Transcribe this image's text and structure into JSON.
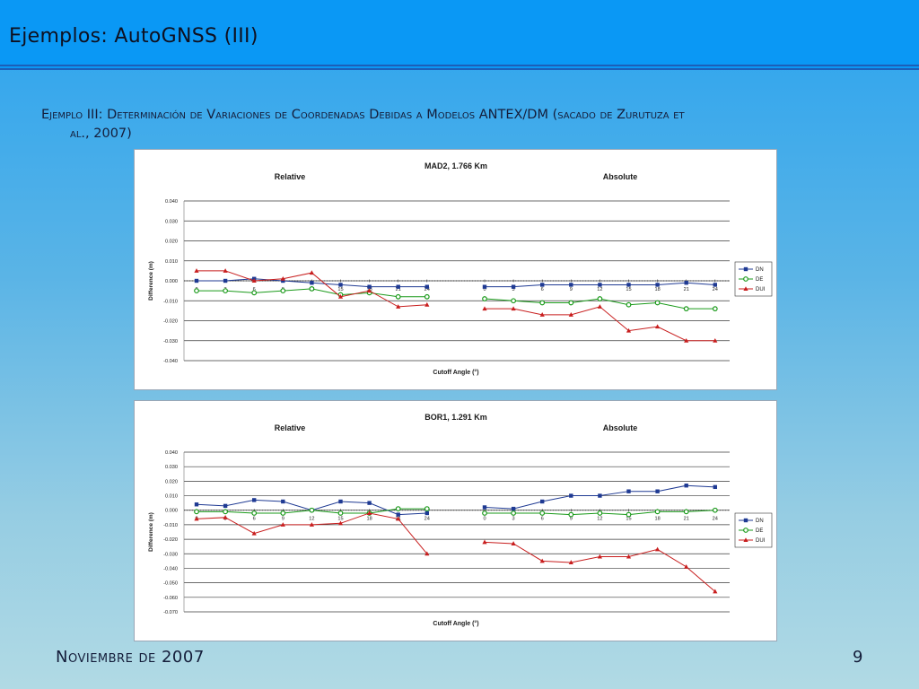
{
  "slide": {
    "title": "Ejemplos: AutoGNSS (III)",
    "subtitle_line1": "Ejemplo III: Determinación de Variaciones de Coordenadas Debidas a Modelos ANTEX/DM (sacado de Zurutuza et",
    "subtitle_line2": "al., 2007)",
    "footer_left": "Noviembre de 2007",
    "footer_right": "9"
  },
  "colors": {
    "DN": "#1f3a93",
    "DE": "#1a9a1a",
    "DUI": "#c81e1e"
  },
  "chart_data": [
    {
      "type": "line",
      "title": "MAD2, 1.766 Km",
      "panel_labels": [
        "Relative",
        "Absolute"
      ],
      "xlabel": "Cutoff Angle (°)",
      "ylabel": "Difference (m)",
      "x": [
        0,
        3,
        6,
        9,
        12,
        15,
        18,
        21,
        24
      ],
      "ylim": [
        -0.04,
        0.04
      ],
      "yticks": [
        "0.040",
        "0.030",
        "0.020",
        "0.010",
        "0.000",
        "-0.010",
        "-0.020",
        "-0.030",
        "-0.040"
      ],
      "grid": true,
      "legend": "right",
      "relative": [
        {
          "name": "DN",
          "values": [
            0.0,
            0.0,
            0.001,
            0.0,
            -0.001,
            -0.002,
            -0.003,
            -0.003,
            -0.003
          ]
        },
        {
          "name": "DE",
          "values": [
            -0.005,
            -0.005,
            -0.006,
            -0.005,
            -0.004,
            -0.007,
            -0.006,
            -0.008,
            -0.008
          ]
        },
        {
          "name": "DUI",
          "values": [
            0.005,
            0.005,
            0.0,
            0.001,
            0.004,
            -0.008,
            -0.005,
            -0.013,
            -0.012
          ]
        }
      ],
      "absolute": [
        {
          "name": "DN",
          "values": [
            -0.003,
            -0.003,
            -0.002,
            -0.002,
            -0.002,
            -0.002,
            -0.002,
            -0.001,
            -0.002
          ]
        },
        {
          "name": "DE",
          "values": [
            -0.009,
            -0.01,
            -0.011,
            -0.011,
            -0.009,
            -0.012,
            -0.011,
            -0.014,
            -0.014
          ]
        },
        {
          "name": "DUI",
          "values": [
            -0.014,
            -0.014,
            -0.017,
            -0.017,
            -0.013,
            -0.025,
            -0.023,
            -0.03,
            -0.03
          ]
        }
      ]
    },
    {
      "type": "line",
      "title": "BOR1, 1.291 Km",
      "panel_labels": [
        "Relative",
        "Absolute"
      ],
      "xlabel": "Cutoff Angle (°)",
      "ylabel": "Difference (m)",
      "x": [
        0,
        3,
        6,
        9,
        12,
        15,
        18,
        21,
        24
      ],
      "ylim": [
        -0.07,
        0.04
      ],
      "yticks": [
        "0.040",
        "0.030",
        "0.020",
        "0.010",
        "0.000",
        "-0.010",
        "-0.020",
        "-0.030",
        "-0.040",
        "-0.050",
        "-0.060",
        "-0.070"
      ],
      "grid": true,
      "legend": "right",
      "relative": [
        {
          "name": "DN",
          "values": [
            0.004,
            0.003,
            0.007,
            0.006,
            0.0,
            0.006,
            0.005,
            -0.003,
            -0.002
          ]
        },
        {
          "name": "DE",
          "values": [
            -0.001,
            -0.001,
            -0.002,
            -0.002,
            0.0,
            -0.002,
            -0.002,
            0.001,
            0.001
          ]
        },
        {
          "name": "DUI",
          "values": [
            -0.006,
            -0.005,
            -0.016,
            -0.01,
            -0.01,
            -0.009,
            -0.002,
            -0.006,
            -0.03
          ]
        }
      ],
      "absolute": [
        {
          "name": "DN",
          "values": [
            0.002,
            0.001,
            0.006,
            0.01,
            0.01,
            0.013,
            0.013,
            0.017,
            0.016
          ]
        },
        {
          "name": "DE",
          "values": [
            -0.002,
            -0.002,
            -0.002,
            -0.003,
            -0.002,
            -0.003,
            -0.001,
            -0.001,
            0.0
          ]
        },
        {
          "name": "DUI",
          "values": [
            -0.022,
            -0.023,
            -0.035,
            -0.036,
            -0.032,
            -0.032,
            -0.027,
            -0.039,
            -0.056
          ]
        }
      ]
    }
  ]
}
